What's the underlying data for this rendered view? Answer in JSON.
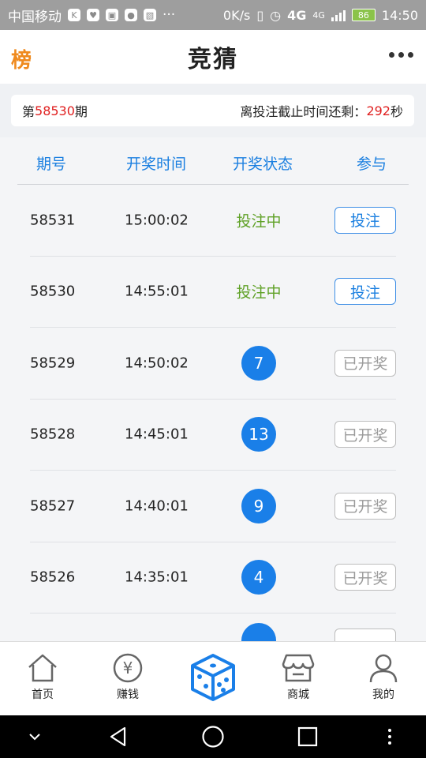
{
  "status_bar": {
    "carrier": "中国移动",
    "speed": "0K/s",
    "network": "4G",
    "network2": "4G",
    "battery": "86",
    "time": "14:50"
  },
  "header": {
    "rank_label": "榜",
    "title": "竞猜"
  },
  "issue_bar": {
    "prefix": "第",
    "issue": "58530",
    "suffix": "期",
    "countdown_label": "离投注截止时间还剩：",
    "countdown_value": "292",
    "countdown_unit": "秒"
  },
  "table": {
    "headers": [
      "期号",
      "开奖时间",
      "开奖状态",
      "参与"
    ],
    "rows": [
      {
        "issue": "58531",
        "time": "15:00:02",
        "status": "投注中",
        "action": "投注"
      },
      {
        "issue": "58530",
        "time": "14:55:01",
        "status": "投注中",
        "action": "投注"
      },
      {
        "issue": "58529",
        "time": "14:50:02",
        "status": "7",
        "action": "已开奖"
      },
      {
        "issue": "58528",
        "time": "14:45:01",
        "status": "13",
        "action": "已开奖"
      },
      {
        "issue": "58527",
        "time": "14:40:01",
        "status": "9",
        "action": "已开奖"
      },
      {
        "issue": "58526",
        "time": "14:35:01",
        "status": "4",
        "action": "已开奖"
      }
    ]
  },
  "bottom_nav": {
    "items": [
      {
        "label": "首页",
        "icon": "home-icon"
      },
      {
        "label": "赚钱",
        "icon": "yen-icon"
      },
      {
        "label": "",
        "icon": "dice-icon"
      },
      {
        "label": "商城",
        "icon": "shop-icon"
      },
      {
        "label": "我的",
        "icon": "user-icon"
      }
    ]
  },
  "colors": {
    "accent": "#1a7fe8",
    "betting_green": "#5fa126",
    "countdown_red": "#e02020",
    "rank_orange": "#ef8a1e"
  }
}
